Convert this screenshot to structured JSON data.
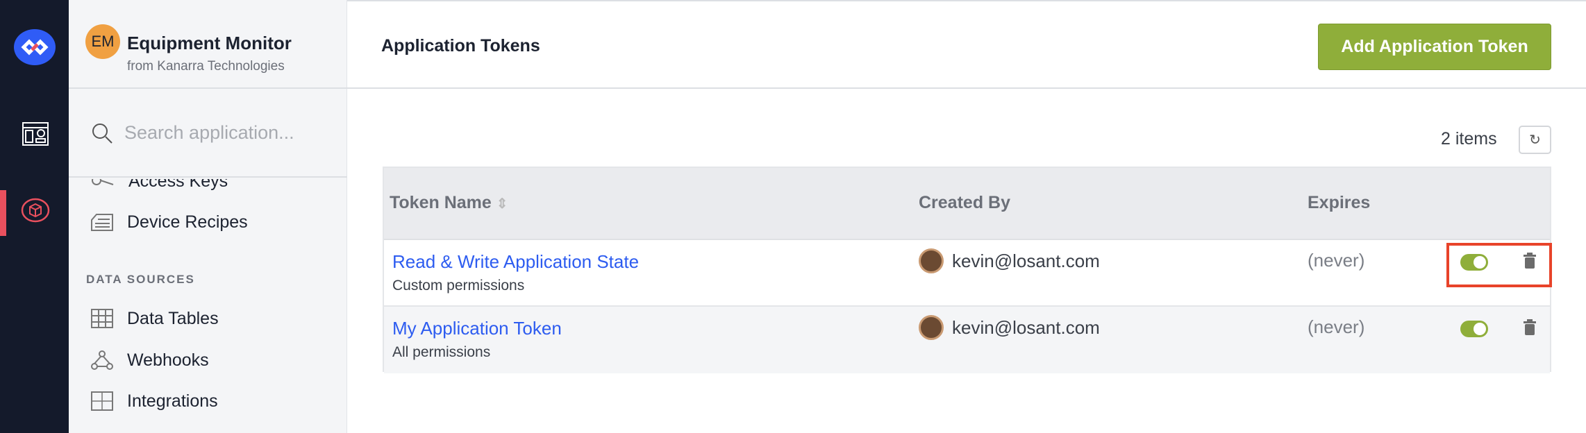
{
  "app": {
    "initials": "EM",
    "name": "Equipment Monitor",
    "org": "from Kanarra Technologies"
  },
  "sidebar": {
    "search_placeholder": "Search application...",
    "items": [
      {
        "label": "Access Keys",
        "icon": "key-icon"
      },
      {
        "label": "Device Recipes",
        "icon": "recipe-icon"
      }
    ],
    "section": "DATA SOURCES",
    "data_items": [
      {
        "label": "Data Tables",
        "icon": "table-icon"
      },
      {
        "label": "Webhooks",
        "icon": "webhook-icon"
      },
      {
        "label": "Integrations",
        "icon": "puzzle-icon"
      }
    ]
  },
  "header": {
    "title": "Application Tokens",
    "add_button": "Add Application Token"
  },
  "list": {
    "count": "2 items",
    "columns": [
      "Token Name",
      "Created By",
      "Expires"
    ],
    "rows": [
      {
        "name": "Read & Write Application State",
        "permissions": "Custom permissions",
        "created_by": "kevin@losant.com",
        "expires": "(never)",
        "enabled": true
      },
      {
        "name": "My Application Token",
        "permissions": "All permissions",
        "created_by": "kevin@losant.com",
        "expires": "(never)",
        "enabled": true
      }
    ]
  },
  "colors": {
    "accent": "#8fae3a",
    "link": "#2d5cf0",
    "rail": "#141a2b",
    "highlight": "#e8432a"
  }
}
